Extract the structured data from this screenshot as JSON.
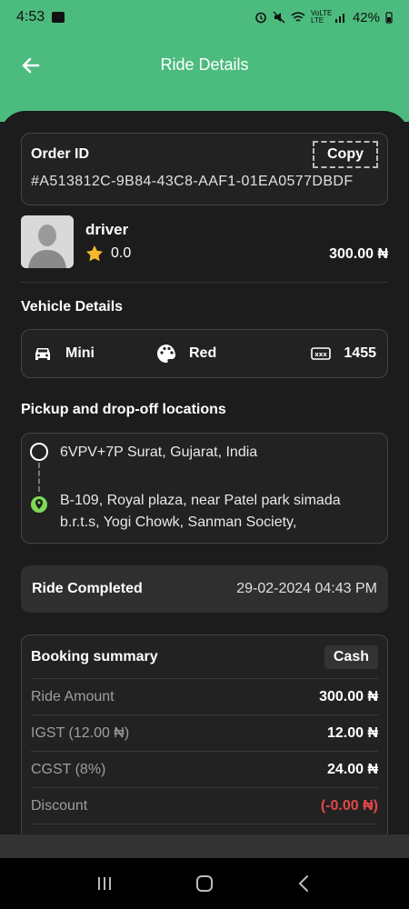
{
  "status_bar": {
    "time": "4:53",
    "battery": "42%",
    "network": "VoLTE LTE"
  },
  "app_bar": {
    "title": "Ride Details"
  },
  "order": {
    "label": "Order ID",
    "copy_label": "Copy",
    "id": "#A513812C-9B84-43C8-AAF1-01EA0577DBDF"
  },
  "driver": {
    "name": "driver",
    "rating": "0.0",
    "fare": "300.00 ₦"
  },
  "vehicle": {
    "title": "Vehicle Details",
    "type": "Mini",
    "color": "Red",
    "plate": "1455"
  },
  "locations": {
    "title": "Pickup and drop-off locations",
    "pickup": "6VPV+7P Surat, Gujarat, India",
    "drop_line1": "B-109, Royal plaza, near Patel park simada",
    "drop_line2": "b.r.t.s, Yogi Chowk, Sanman Society,"
  },
  "ride_status": {
    "label": "Ride Completed",
    "datetime": "29-02-2024 04:43 PM"
  },
  "summary": {
    "title": "Booking summary",
    "payment": "Cash",
    "rows": [
      {
        "label": "Ride Amount",
        "value": "300.00 ₦"
      },
      {
        "label": "IGST (12.00 ₦)",
        "value": "12.00 ₦"
      },
      {
        "label": "CGST (8%)",
        "value": "24.00 ₦"
      },
      {
        "label": "Discount",
        "value": "(-0.00 ₦)"
      }
    ]
  },
  "colors": {
    "accent": "#4cbb7e",
    "background": "#1c1c1c",
    "card": "#222222",
    "negative": "#e04848",
    "star": "#f5b82e"
  },
  "icons": [
    "back-arrow-icon",
    "copy-icon",
    "star-icon",
    "car-icon",
    "palette-icon",
    "license-plate-icon",
    "pickup-circle-icon",
    "drop-pin-icon",
    "recents-icon",
    "home-icon",
    "back-nav-icon"
  ]
}
